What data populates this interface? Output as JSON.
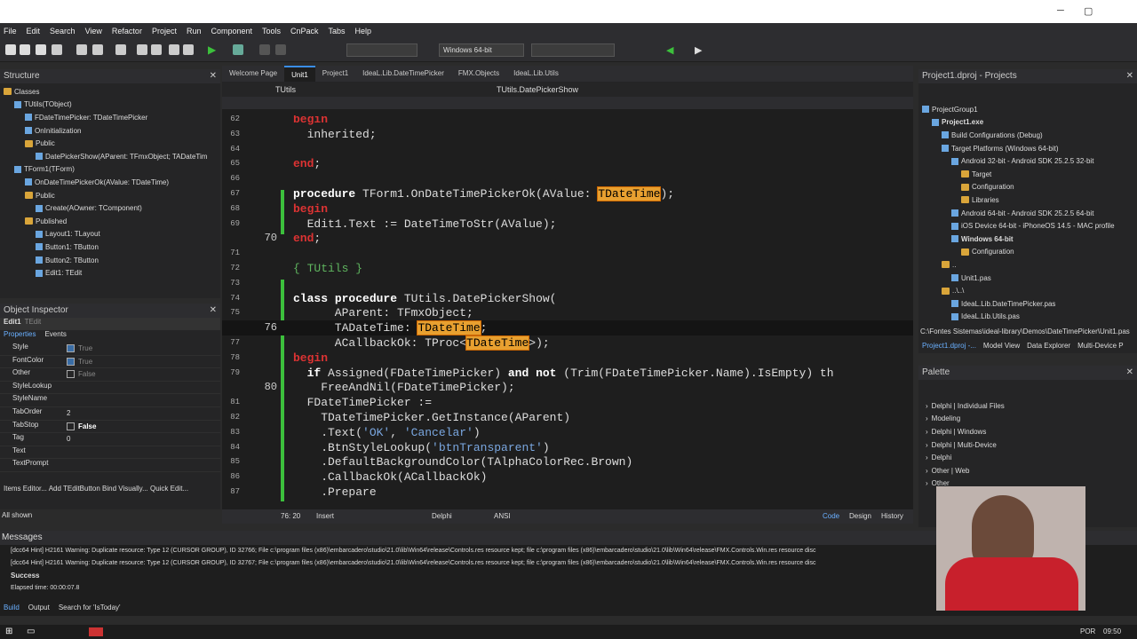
{
  "menu": [
    "File",
    "Edit",
    "Search",
    "View",
    "Refactor",
    "Project",
    "Run",
    "Component",
    "Tools",
    "CnPack",
    "Tabs",
    "Help"
  ],
  "toolbar": {
    "platform": "Windows 64-bit"
  },
  "structure": {
    "title": "Structure",
    "items": [
      {
        "label": "Classes",
        "indent": 0,
        "icon": "folder"
      },
      {
        "label": "TUtils(TObject)",
        "indent": 1,
        "icon": "class"
      },
      {
        "label": "FDateTimePicker: TDateTimePicker",
        "indent": 2,
        "icon": "field"
      },
      {
        "label": "OnInitialization",
        "indent": 2,
        "icon": "method"
      },
      {
        "label": "Public",
        "indent": 2,
        "icon": "folder"
      },
      {
        "label": "DatePickerShow(AParent: TFmxObject; TADateTim",
        "indent": 3,
        "icon": "method"
      },
      {
        "label": "TForm1(TForm)",
        "indent": 1,
        "icon": "class"
      },
      {
        "label": "OnDateTimePickerOk(AValue: TDateTime)",
        "indent": 2,
        "icon": "method"
      },
      {
        "label": "Public",
        "indent": 2,
        "icon": "folder"
      },
      {
        "label": "Create(AOwner: TComponent)",
        "indent": 3,
        "icon": "method"
      },
      {
        "label": "Published",
        "indent": 2,
        "icon": "folder"
      },
      {
        "label": "Layout1: TLayout",
        "indent": 3,
        "icon": "field"
      },
      {
        "label": "Button1: TButton",
        "indent": 3,
        "icon": "field"
      },
      {
        "label": "Button2: TButton",
        "indent": 3,
        "icon": "field"
      },
      {
        "label": "Edit1: TEdit",
        "indent": 3,
        "icon": "field"
      }
    ]
  },
  "object_inspector": {
    "title": "Object Inspector",
    "selected": "Edit1",
    "selected_type": "TEdit",
    "tab_properties": "Properties",
    "tab_events": "Events",
    "props": [
      {
        "name": "Style",
        "value": "True",
        "check": true,
        "checked": true
      },
      {
        "name": "FontColor",
        "value": "True",
        "check": true,
        "checked": true
      },
      {
        "name": "Other",
        "value": "False",
        "check": true,
        "checked": false
      },
      {
        "name": "StyleLookup",
        "value": "",
        "check": false
      },
      {
        "name": "StyleName",
        "value": "",
        "check": false
      },
      {
        "name": "TabOrder",
        "value": "2",
        "check": false
      },
      {
        "name": "TabStop",
        "value": "False",
        "check": true,
        "checked": false
      },
      {
        "name": "Tag",
        "value": "0",
        "check": false
      },
      {
        "name": "Text",
        "value": "",
        "check": false
      },
      {
        "name": "TextPrompt",
        "value": "",
        "check": false
      }
    ],
    "links": "Items Editor...  Add TEditButton  Bind Visually...  Quick Edit...",
    "footer": "All shown"
  },
  "editor": {
    "tabs": [
      "Welcome Page",
      "Unit1",
      "Project1",
      "IdeaL.Lib.DateTimePicker",
      "FMX.Objects",
      "IdeaL.Lib.Utils"
    ],
    "active_tab": 1,
    "crumb_left": "TUtils",
    "crumb_right": "TUtils.DatePickerShow",
    "status_pos": "76: 20",
    "status_mode": "Insert",
    "status_lang": "Delphi",
    "status_enc": "ANSI",
    "view_code": "Code",
    "view_design": "Design",
    "view_history": "History"
  },
  "code_lines": [
    {
      "n": "62",
      "big": ""
    },
    {
      "n": "63",
      "big": ""
    },
    {
      "n": "64",
      "big": ""
    },
    {
      "n": "65",
      "big": ""
    },
    {
      "n": "66",
      "big": ""
    },
    {
      "n": "67",
      "big": ""
    },
    {
      "n": "68",
      "big": ""
    },
    {
      "n": "69",
      "big": ""
    },
    {
      "n": "",
      "big": "70"
    },
    {
      "n": "71",
      "big": ""
    },
    {
      "n": "72",
      "big": ""
    },
    {
      "n": "73",
      "big": ""
    },
    {
      "n": "74",
      "big": ""
    },
    {
      "n": "75",
      "big": ""
    },
    {
      "n": "",
      "big": "76"
    },
    {
      "n": "77",
      "big": ""
    },
    {
      "n": "78",
      "big": ""
    },
    {
      "n": "79",
      "big": ""
    },
    {
      "n": "",
      "big": "80"
    },
    {
      "n": "81",
      "big": ""
    },
    {
      "n": "82",
      "big": ""
    },
    {
      "n": "83",
      "big": ""
    },
    {
      "n": "84",
      "big": ""
    },
    {
      "n": "85",
      "big": ""
    },
    {
      "n": "86",
      "big": ""
    },
    {
      "n": "87",
      "big": ""
    }
  ],
  "projects": {
    "title": "Project1.dproj - Projects",
    "items": [
      {
        "label": "ProjectGroup1",
        "indent": 0,
        "bold": false
      },
      {
        "label": "Project1.exe",
        "indent": 1,
        "bold": true
      },
      {
        "label": "Build Configurations (Debug)",
        "indent": 2,
        "bold": false
      },
      {
        "label": "Target Platforms (Windows 64-bit)",
        "indent": 2,
        "bold": false
      },
      {
        "label": "Android 32-bit - Android SDK 25.2.5 32-bit",
        "indent": 3,
        "bold": false
      },
      {
        "label": "Target",
        "indent": 4,
        "bold": false
      },
      {
        "label": "Configuration",
        "indent": 4,
        "bold": false
      },
      {
        "label": "Libraries",
        "indent": 4,
        "bold": false
      },
      {
        "label": "Android 64-bit - Android SDK 25.2.5 64-bit",
        "indent": 3,
        "bold": false
      },
      {
        "label": "iOS Device 64-bit - iPhoneOS 14.5 - MAC profile",
        "indent": 3,
        "bold": false
      },
      {
        "label": "Windows 64-bit",
        "indent": 3,
        "bold": true
      },
      {
        "label": "Configuration",
        "indent": 4,
        "bold": false
      },
      {
        "label": "..",
        "indent": 2,
        "bold": false
      },
      {
        "label": "Unit1.pas",
        "indent": 3,
        "bold": false
      },
      {
        "label": "..\\..\\",
        "indent": 2,
        "bold": false
      },
      {
        "label": "IdeaL.Lib.DateTimePicker.pas",
        "indent": 3,
        "bold": false
      },
      {
        "label": "IdeaL.Lib.Utils.pas",
        "indent": 3,
        "bold": false
      }
    ],
    "path": "C:\\Fontes Sistemas\\ideal-library\\Demos\\DateTimePicker\\Unit1.pas",
    "bottom_tabs": [
      "Project1.dproj -...",
      "Model View",
      "Data Explorer",
      "Multi-Device P"
    ]
  },
  "palette": {
    "title": "Palette",
    "items": [
      "Delphi | Individual Files",
      "Modeling",
      "Delphi | Windows",
      "Delphi | Multi-Device",
      "Delphi",
      "Other | Web",
      "Other"
    ]
  },
  "messages": {
    "title": "Messages",
    "lines": [
      "[dcc64 Hint] H2161 Warning: Duplicate resource:  Type 12 (CURSOR GROUP), ID 32766; File c:\\program files (x86)\\embarcadero\\studio\\21.0\\lib\\Win64\\release\\Controls.res resource kept; file c:\\program files (x86)\\embarcadero\\studio\\21.0\\lib\\Win64\\release\\FMX.Controls.Win.res resource disc",
      "[dcc64 Hint] H2161 Warning: Duplicate resource:  Type 12 (CURSOR GROUP), ID 32767; File c:\\program files (x86)\\embarcadero\\studio\\21.0\\lib\\Win64\\release\\Controls.res resource kept; file c:\\program files (x86)\\embarcadero\\studio\\21.0\\lib\\Win64\\release\\FMX.Controls.Win.res resource disc"
    ],
    "success": "Success",
    "elapsed": "Elapsed time: 00:00:07.8",
    "tabs": [
      "Build",
      "Output",
      "Search for 'IsToday'"
    ]
  },
  "taskbar": {
    "lang": "POR",
    "time": "09:50"
  }
}
